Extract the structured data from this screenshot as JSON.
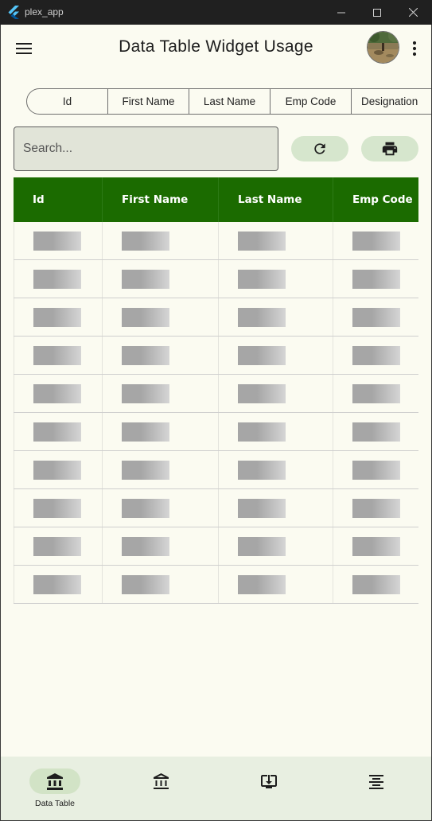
{
  "window": {
    "title": "plex_app",
    "logo_icon": "flutter-logo-icon"
  },
  "appbar": {
    "title": "Data Table Widget Usage",
    "menu_icon": "hamburger-menu-icon",
    "more_icon": "more-vert-icon"
  },
  "column_selector": {
    "segments": [
      "Id",
      "First Name",
      "Last Name",
      "Emp Code",
      "Designation"
    ]
  },
  "search": {
    "placeholder": "Search...",
    "value": ""
  },
  "actions": {
    "refresh_icon": "refresh-icon",
    "print_icon": "print-icon"
  },
  "table": {
    "header_color": "#1b6b00",
    "columns": [
      "Id",
      "First Name",
      "Last Name",
      "Emp Code"
    ],
    "row_count": 10,
    "loading": true
  },
  "bottom_nav": {
    "items": [
      {
        "label": "Data Table",
        "icon": "bank-icon",
        "active": true
      },
      {
        "label": "",
        "icon": "bank-outline-icon",
        "active": false
      },
      {
        "label": "",
        "icon": "download-to-screen-icon",
        "active": false
      },
      {
        "label": "",
        "icon": "align-center-icon",
        "active": false
      }
    ]
  },
  "colors": {
    "background": "#fbfbf1",
    "accent": "#1b6b00",
    "pill_button": "#d6e6cd",
    "nav_bar": "#e8efe1"
  }
}
